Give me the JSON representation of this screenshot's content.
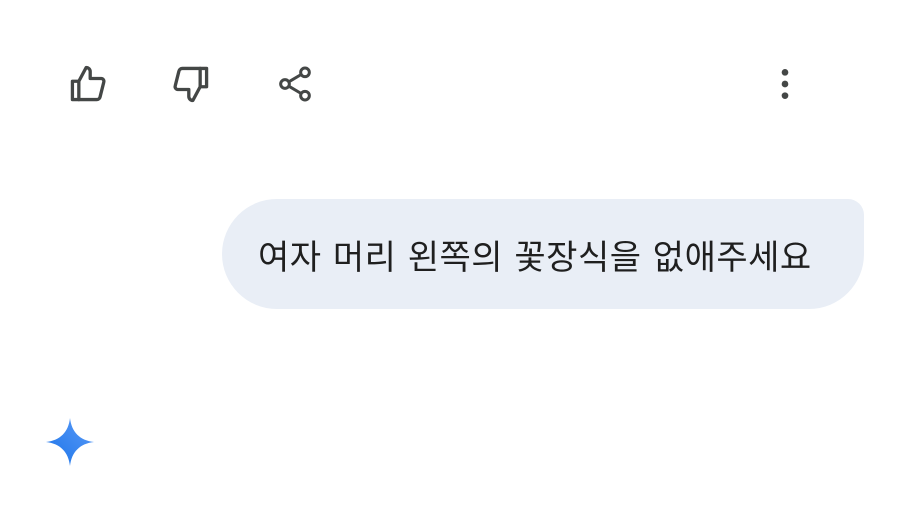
{
  "actions": {
    "like_icon": "thumbs-up-icon",
    "dislike_icon": "thumbs-down-icon",
    "share_icon": "share-icon",
    "more_icon": "more-vert-icon"
  },
  "chat": {
    "user_message": "여자 머리 왼쪽의 꽃장식을 없애주세요",
    "bubble_color": "#e9eef6",
    "text_color": "#1f1f1f"
  },
  "assistant": {
    "avatar_icon": "gemini-sparkle-icon",
    "accent_gradient": [
      "#4285f4",
      "#1a73e8"
    ]
  }
}
